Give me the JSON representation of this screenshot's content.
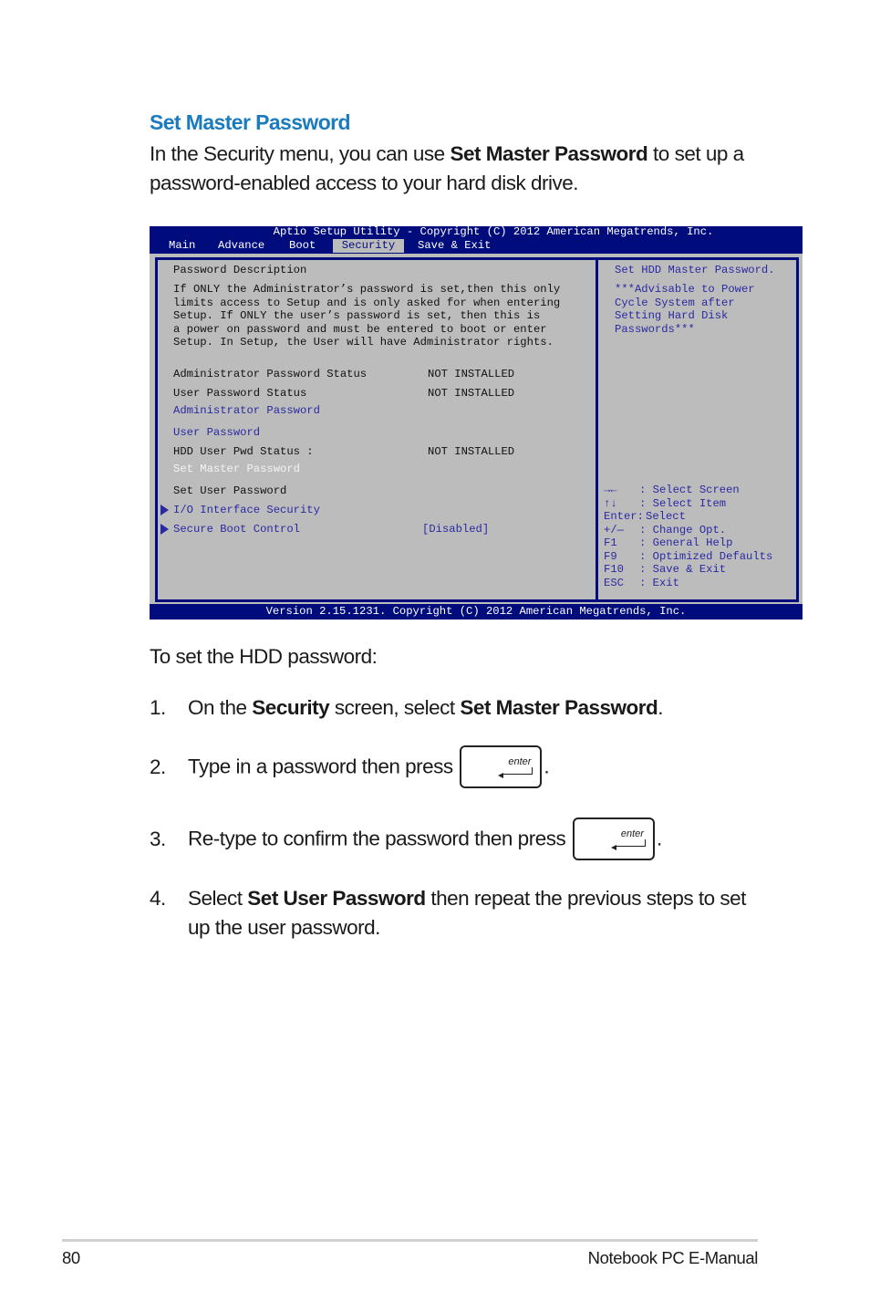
{
  "section": {
    "heading": "Set Master Password",
    "intro_before": "In the Security menu, you can use ",
    "intro_bold": "Set Master Password",
    "intro_after": " to set up a password-enabled access to your hard disk drive."
  },
  "bios": {
    "title": "Aptio Setup Utility - Copyright (C) 2012 American Megatrends, Inc.",
    "tabs": [
      {
        "label": "Main",
        "active": false
      },
      {
        "label": "Advance",
        "active": false
      },
      {
        "label": "Boot",
        "active": false
      },
      {
        "label": "Security",
        "active": true
      },
      {
        "label": "Save & Exit",
        "active": false
      }
    ],
    "description_title": "Password Description",
    "description_lines": [
      "If ONLY the Administrator’s password is set,then this only",
      "limits access to Setup and is only asked for when entering",
      "Setup. If ONLY the user’s password is set, then this is",
      "a power on password and must be entered to boot or enter",
      "Setup. In Setup, the User will have Administrator rights."
    ],
    "items": [
      {
        "label": "Administrator Password Status",
        "value": "NOT INSTALLED",
        "style": "static"
      },
      {
        "label": "User Password Status",
        "value": "NOT INSTALLED",
        "style": "static"
      },
      {
        "label": "Administrator Password",
        "value": "",
        "style": "selectable"
      },
      {
        "label": "User Password",
        "value": "",
        "style": "selectable"
      },
      {
        "label": "HDD User Pwd Status :",
        "value": "NOT INSTALLED",
        "style": "static"
      },
      {
        "label": "Set Master Password",
        "value": "",
        "style": "highlighted"
      },
      {
        "label": "Set User Password",
        "value": "",
        "style": "static"
      },
      {
        "label": "I/O Interface Security",
        "value": "",
        "style": "submenu"
      },
      {
        "label": "Secure Boot Control",
        "value": "[Disabled]",
        "style": "submenu"
      }
    ],
    "help": {
      "title": "Set HDD Master Password.",
      "note_lines": [
        "***Advisable to Power",
        "Cycle System after",
        "Setting Hard Disk",
        "Passwords***"
      ]
    },
    "keys": [
      {
        "key": "→←",
        "sep": ": ",
        "action": "Select Screen"
      },
      {
        "key": "↑↓",
        "sep": ": ",
        "action": "Select Item"
      },
      {
        "key": "Enter:",
        "sep": "",
        "action": "Select"
      },
      {
        "key": "+/—",
        "sep": ": ",
        "action": "Change Opt."
      },
      {
        "key": "F1",
        "sep": ": ",
        "action": "General Help"
      },
      {
        "key": "F9",
        "sep": ": ",
        "action": "Optimized Defaults"
      },
      {
        "key": "F10",
        "sep": ": ",
        "action": "Save & Exit"
      },
      {
        "key": "ESC",
        "sep": ": ",
        "action": "Exit"
      }
    ],
    "footer": "Version 2.15.1231. Copyright (C) 2012 American Megatrends, Inc.",
    "colors": {
      "bar": "#000c7c",
      "panel": "#bcbcbc",
      "item_blue": "#2929a3",
      "highlight": "#f4f4f4"
    }
  },
  "instructions": {
    "intro": "To set the HDD password:",
    "steps": [
      {
        "num": "1.",
        "pre": "On the ",
        "b1": "Security",
        "mid": " screen, select ",
        "b2": "Set Master Password",
        "post": "."
      },
      {
        "num": "2.",
        "pre": "Type in a password then press ",
        "post": "."
      },
      {
        "num": "3.",
        "pre": "Re-type to confirm the password then press ",
        "post": "."
      },
      {
        "num": "4.",
        "pre": "Select ",
        "b1": "Set User Password",
        "post": " then repeat the previous steps to set up the user password."
      }
    ],
    "enter_key_label": "enter"
  },
  "footer": {
    "page_number": "80",
    "manual_name": "Notebook PC E-Manual"
  }
}
